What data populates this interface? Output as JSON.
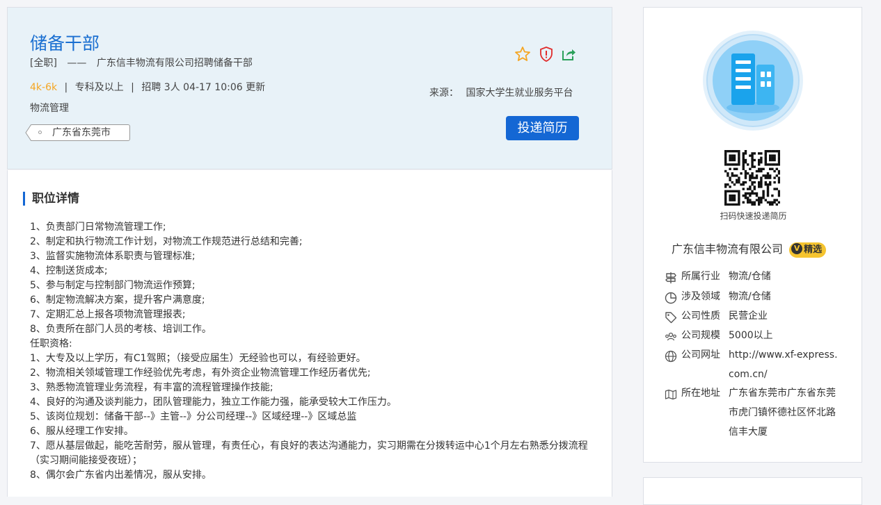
{
  "job": {
    "title": "储备干部",
    "type": "[全职]",
    "dash": "——",
    "subtitle": "广东信丰物流有限公司招聘储备干部",
    "salary": "4k-6k",
    "education": "专科及以上",
    "headcount": "招聘 3人",
    "updated": "04-17 10:06 更新",
    "category": "物流管理",
    "location": "广东省东莞市",
    "source_label": "来源：",
    "source": "国家大学生就业服务平台",
    "apply_label": "投递简历",
    "separator": "|"
  },
  "icons": [
    "star-icon",
    "shield-report-icon",
    "share-icon"
  ],
  "colors": {
    "accent": "#1467d4",
    "salary": "#f5a623",
    "badge": "#f5c430",
    "header_bg": "#e8f2f8"
  },
  "details": {
    "section_title": "职位详情",
    "lines": [
      "1、负责部门日常物流管理工作;",
      "2、制定和执行物流工作计划，对物流工作规范进行总结和完善;",
      "3、监督实施物流体系职责与管理标准;",
      "4、控制送货成本;",
      "5、参与制定与控制部门物流运作预算;",
      "6、制定物流解决方案，提升客户满意度;",
      "7、定期汇总上报各项物流管理报表;",
      "8、负责所在部门人员的考核、培训工作。",
      "任职资格:",
      "1、大专及以上学历，有C1驾照；（接受应届生）无经验也可以，有经验更好。",
      "2、物流相关领域管理工作经验优先考虑，有外资企业物流管理工作经历者优先;",
      "3、熟悉物流管理业务流程，有丰富的流程管理操作技能;",
      "4、良好的沟通及谈判能力，团队管理能力，独立工作能力强，能承受较大工作压力。",
      "5、该岗位规划：储备干部--》主管--》分公司经理--》区域经理--》区域总监",
      "6、服从经理工作安排。",
      "7、愿从基层做起，能吃苦耐劳，服从管理，有责任心，有良好的表达沟通能力，实习期需在分拨转运中心1个月左右熟悉分拨流程（实习期间能接受夜班）；",
      "8、偶尔会广东省内出差情况，服从安排。"
    ]
  },
  "company": {
    "qr_caption": "扫码快速投递简历",
    "name": "广东信丰物流有限公司",
    "badge_v": "V",
    "badge": "精选",
    "industry_label": "所属行业",
    "industry": "物流/仓储",
    "field_label": "涉及领域",
    "field": "物流/仓储",
    "nature_label": "公司性质",
    "nature": "民营企业",
    "scale_label": "公司规模",
    "scale": "5000以上",
    "website_label": "公司网址",
    "website": "http://www.xf-express.com.cn/",
    "address_label": "所在地址",
    "address": "广东省东莞市广东省东莞市虎门镇怀德社区怀北路信丰大厦"
  }
}
